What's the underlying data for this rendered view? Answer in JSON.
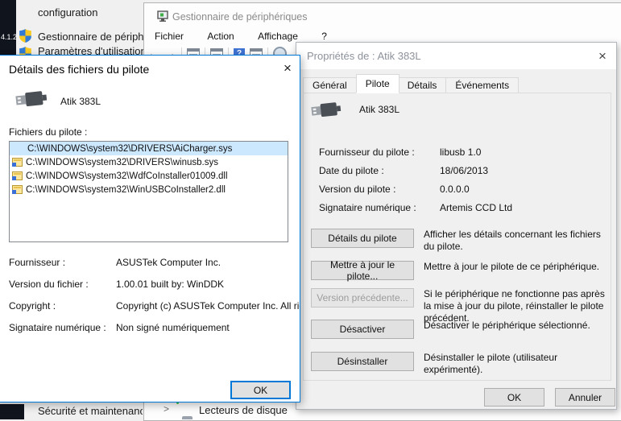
{
  "background": {
    "line1": "configuration",
    "entry1": "Gestionnaire de périphéri",
    "entry2": "Paramètres d'utilisation",
    "version": "4.1.2",
    "bottom_link": "Sécurité et maintenance",
    "tree_item": "Lecteurs de disque"
  },
  "device_manager": {
    "title": "Gestionnaire de périphériques",
    "menus": [
      "Fichier",
      "Action",
      "Affichage",
      "?"
    ],
    "toolbar_icons": [
      "back-icon",
      "forward-icon",
      "console-tree-icon",
      "properties-icon",
      "help-icon",
      "action-pane-icon",
      "scan-hardware-icon"
    ]
  },
  "driver_details": {
    "title": "Détails des fichiers du pilote",
    "device_name": "Atik 383L",
    "files_label": "Fichiers du pilote :",
    "files": [
      "C:\\WINDOWS\\system32\\DRIVERS\\AiCharger.sys",
      "C:\\WINDOWS\\system32\\DRIVERS\\winusb.sys",
      "C:\\WINDOWS\\system32\\WdfCoInstaller01009.dll",
      "C:\\WINDOWS\\system32\\WinUSBCoInstaller2.dll"
    ],
    "fields": [
      {
        "label": "Fournisseur :",
        "value": "ASUSTek Computer Inc."
      },
      {
        "label": "Version du fichier :",
        "value": "1.00.01 built by: WinDDK"
      },
      {
        "label": "Copyright :",
        "value": "Copyright (c) ASUSTek Computer Inc. All rights"
      },
      {
        "label": "Signataire numérique :",
        "value": "Non signé numériquement"
      }
    ],
    "ok_label": "OK"
  },
  "properties": {
    "title": "Propriétés de : Atik 383L",
    "tabs": [
      "Général",
      "Pilote",
      "Détails",
      "Événements"
    ],
    "active_tab": "Pilote",
    "device_name": "Atik 383L",
    "fields": [
      {
        "label": "Fournisseur du pilote :",
        "value": "libusb 1.0"
      },
      {
        "label": "Date du pilote :",
        "value": "18/06/2013"
      },
      {
        "label": "Version du pilote :",
        "value": "0.0.0.0"
      },
      {
        "label": "Signataire numérique :",
        "value": "Artemis CCD Ltd"
      }
    ],
    "actions": [
      {
        "label": "Détails du pilote",
        "desc": "Afficher les détails concernant les fichiers du pilote."
      },
      {
        "label": "Mettre à jour le pilote...",
        "desc": "Mettre à jour le pilote de ce périphérique."
      },
      {
        "label": "Version précédente...",
        "desc": "Si le périphérique ne fonctionne pas après la mise à jour du pilote, réinstaller le pilote précédent."
      },
      {
        "label": "Désactiver",
        "desc": "Désactiver le périphérique sélectionné."
      },
      {
        "label": "Désinstaller",
        "desc": "Désinstaller le pilote (utilisateur expérimenté)."
      }
    ],
    "ok_label": "OK",
    "cancel_label": "Annuler"
  },
  "icons": {
    "close": "×",
    "chevron": ">",
    "help": "?"
  },
  "colors": {
    "accent": "#0078d7",
    "selection": "#cce8ff",
    "inactive_title": "#8d929b",
    "disabled_text": "#9c9c9c"
  }
}
